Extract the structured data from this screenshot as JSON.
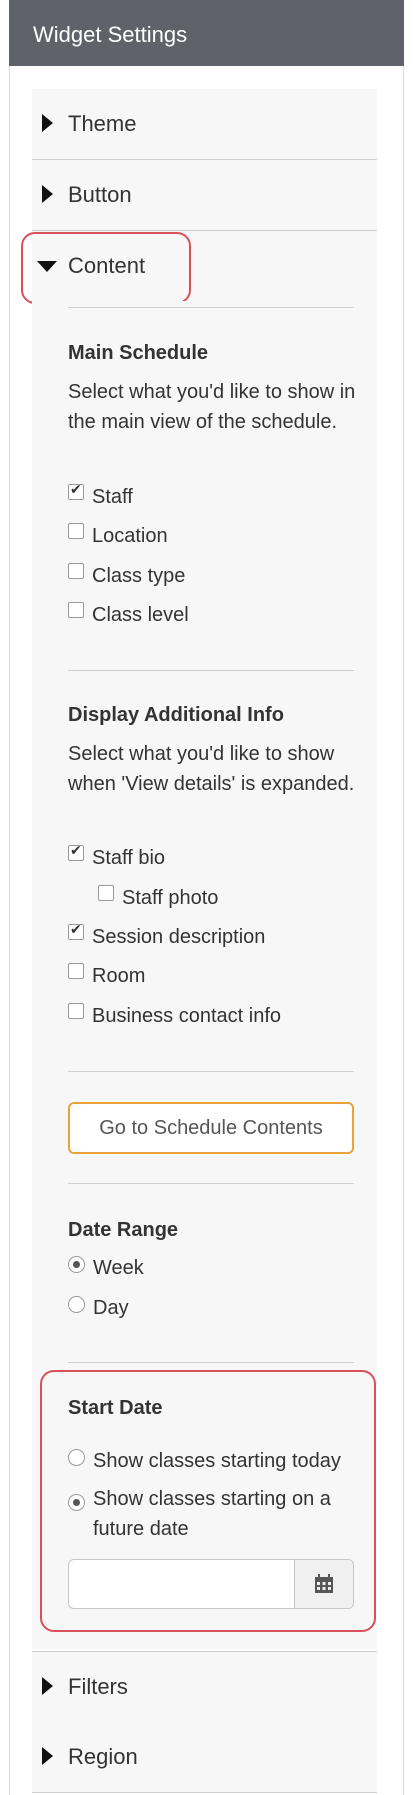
{
  "header": {
    "title": "Widget Settings"
  },
  "accordion": {
    "theme": "Theme",
    "button": "Button",
    "content": "Content",
    "filters": "Filters",
    "region": "Region"
  },
  "main_schedule": {
    "title": "Main Schedule",
    "description": "Select what you'd like to show in the main view of the schedule.",
    "options": [
      {
        "label": "Staff",
        "checked": true
      },
      {
        "label": "Location",
        "checked": false
      },
      {
        "label": "Class type",
        "checked": false
      },
      {
        "label": "Class level",
        "checked": false
      }
    ]
  },
  "additional_info": {
    "title": "Display Additional Info",
    "description": "Select what you'd like to show when 'View details' is expanded.",
    "options": [
      {
        "label": "Staff bio",
        "checked": true
      },
      {
        "label": "Staff photo",
        "checked": false
      },
      {
        "label": "Session description",
        "checked": true
      },
      {
        "label": "Room",
        "checked": false
      },
      {
        "label": "Business contact info",
        "checked": false
      }
    ]
  },
  "schedule_button": {
    "label": "Go to Schedule Contents"
  },
  "date_range": {
    "title": "Date Range",
    "options": [
      {
        "label": "Week",
        "selected": true
      },
      {
        "label": "Day",
        "selected": false
      }
    ]
  },
  "start_date": {
    "title": "Start Date",
    "options": [
      {
        "label": "Show classes starting today",
        "selected": false
      },
      {
        "label": "Show classes starting on a future date",
        "selected": true
      }
    ],
    "date_value": "",
    "calendar_icon": "calendar-icon"
  },
  "colors": {
    "header_bg": "#5f6369",
    "highlight": "#d9505a",
    "button_border": "#e8a33c"
  }
}
